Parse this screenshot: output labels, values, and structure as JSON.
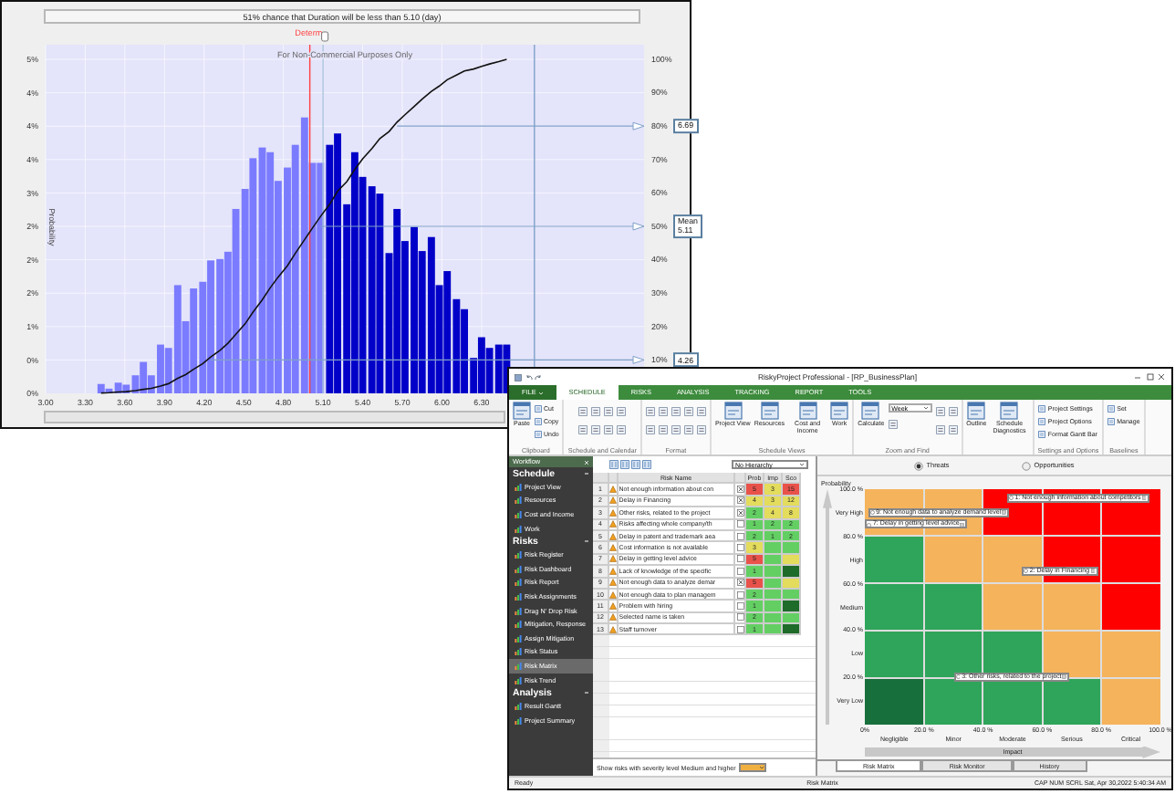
{
  "chart_window": {
    "header": "51% chance that Duration will be less than 5.10 (day)",
    "notice": "For Non-Commercial Purposes Only",
    "chart_data": {
      "type": "bar",
      "ylabel": "Probability",
      "x": [
        3.42,
        3.48,
        3.55,
        3.61,
        3.68,
        3.74,
        3.8,
        3.87,
        3.93,
        4.0,
        4.06,
        4.12,
        4.19,
        4.25,
        4.32,
        4.38,
        4.44,
        4.51,
        4.57,
        4.64,
        4.7,
        4.76,
        4.83,
        4.89,
        4.96,
        5.02,
        5.08,
        5.15,
        5.21,
        5.28,
        5.34,
        5.4,
        5.47,
        5.53,
        5.6,
        5.66,
        5.72,
        5.79,
        5.85,
        5.92,
        5.98,
        6.04,
        6.11,
        6.17,
        6.24,
        6.3,
        6.36,
        6.43,
        6.49
      ],
      "series": [
        {
          "color": "#7b7bff",
          "values": [
            0.14,
            0.07,
            0.16,
            0.13,
            0.27,
            0.47,
            0.27,
            0.73,
            0.68,
            1.62,
            1.08,
            1.57,
            1.67,
            1.99,
            2.01,
            2.12,
            2.76,
            3.06,
            3.52,
            3.68,
            3.61,
            3.18,
            3.38,
            3.72,
            4.13,
            3.45,
            3.45,
            null,
            null,
            null,
            null,
            null,
            null,
            null,
            null,
            null,
            null,
            null,
            null,
            null,
            null,
            null,
            null,
            null,
            null,
            null,
            null,
            null,
            null
          ]
        },
        {
          "color": "#0000c8",
          "values": [
            null,
            null,
            null,
            null,
            null,
            null,
            null,
            null,
            null,
            null,
            null,
            null,
            null,
            null,
            null,
            null,
            null,
            null,
            null,
            null,
            null,
            null,
            null,
            null,
            null,
            null,
            null,
            3.72,
            3.89,
            2.83,
            3.61,
            3.24,
            3.1,
            2.99,
            2.1,
            2.76,
            2.28,
            2.49,
            2.13,
            2.34,
            1.62,
            1.83,
            1.41,
            1.26,
            0.53,
            0.84,
            0.68,
            0.73,
            0.73
          ]
        },
        {
          "type": "line",
          "axis": "y2",
          "color": "#111111",
          "values": [
            0.001,
            0.002,
            0.004,
            0.005,
            0.008,
            0.012,
            0.015,
            0.022,
            0.029,
            0.045,
            0.056,
            0.072,
            0.089,
            0.109,
            0.129,
            0.15,
            0.177,
            0.208,
            0.243,
            0.28,
            0.316,
            0.348,
            0.382,
            0.419,
            0.46,
            0.495,
            0.529,
            0.566,
            0.605,
            0.634,
            0.67,
            0.702,
            0.733,
            0.763,
            0.784,
            0.812,
            0.834,
            0.859,
            0.881,
            0.904,
            0.92,
            0.939,
            0.953,
            0.965,
            0.971,
            0.979,
            0.986,
            0.993,
            1.0
          ]
        }
      ],
      "xlim": [
        3.0,
        7.53
      ],
      "ylim": [
        0,
        5
      ],
      "y2lim": [
        0,
        1
      ],
      "grid": true,
      "xticks": [
        {
          "value": 3.0,
          "label": "3.00"
        },
        {
          "value": 3.3,
          "label": "3.30"
        },
        {
          "value": 3.6,
          "label": "3.60"
        },
        {
          "value": 3.9,
          "label": "3.90"
        },
        {
          "value": 4.2,
          "label": "4.20"
        },
        {
          "value": 4.5,
          "label": "4.50"
        },
        {
          "value": 4.8,
          "label": "4.80"
        },
        {
          "value": 5.1,
          "label": "5.10"
        },
        {
          "value": 5.4,
          "label": "5.40"
        },
        {
          "value": 5.7,
          "label": "5.70"
        },
        {
          "value": 6.0,
          "label": "6.00"
        },
        {
          "value": 6.3,
          "label": "6.30"
        }
      ],
      "yticks": [
        {
          "value": 0,
          "label": "0%"
        },
        {
          "value": 0.5,
          "label": "0%"
        },
        {
          "value": 1,
          "label": "1%"
        },
        {
          "value": 1.5,
          "label": "2%"
        },
        {
          "value": 2,
          "label": "2%"
        },
        {
          "value": 2.5,
          "label": "2%"
        },
        {
          "value": 3,
          "label": "3%"
        },
        {
          "value": 3.5,
          "label": "4%"
        },
        {
          "value": 4,
          "label": "4%"
        },
        {
          "value": 4.5,
          "label": "4%"
        },
        {
          "value": 5,
          "label": "5%"
        }
      ],
      "y2ticks": [
        {
          "value": 0.1,
          "label": "10%"
        },
        {
          "value": 0.2,
          "label": "20%"
        },
        {
          "value": 0.3,
          "label": "30%"
        },
        {
          "value": 0.4,
          "label": "40%"
        },
        {
          "value": 0.5,
          "label": "50%"
        },
        {
          "value": 0.6,
          "label": "60%"
        },
        {
          "value": 0.7,
          "label": "70%"
        },
        {
          "value": 0.8,
          "label": "80%"
        },
        {
          "value": 0.9,
          "label": "90%"
        },
        {
          "value": 1,
          "label": "100%"
        }
      ],
      "ref_lines": [
        {
          "axis": "x",
          "value": 5.1,
          "color": "#a8c4dc"
        },
        {
          "axis": "x",
          "value": 5.0,
          "color": "#ff4040",
          "label": "Determ."
        },
        {
          "axis": "x",
          "value": 6.7,
          "color": "#7fa0c8"
        },
        {
          "axis": "y2",
          "value": 0.8,
          "color": "#7fa0c8"
        },
        {
          "axis": "y2",
          "value": 0.5,
          "color": "#7fa0c8"
        },
        {
          "axis": "y2",
          "value": 0.1,
          "color": "#7fa0c8"
        }
      ],
      "annotations": [
        "6.69",
        "Mean 5.11",
        "4.26"
      ]
    }
  },
  "app": {
    "title": "RiskyProject Professional - [RP_BusinessPlan]",
    "ribbon_tabs": [
      {
        "label": "FILE",
        "kind": "menu",
        "selected": false
      },
      {
        "label": "SCHEDULE",
        "kind": "tab",
        "selected": true
      },
      {
        "label": "RISKS",
        "kind": "tab",
        "selected": false
      },
      {
        "label": "ANALYSIS",
        "kind": "tab",
        "selected": false
      },
      {
        "label": "TRACKING",
        "kind": "tab",
        "selected": false
      },
      {
        "label": "REPORT",
        "kind": "tab",
        "selected": false
      },
      {
        "label": "TOOLS",
        "kind": "tab",
        "selected": false
      }
    ],
    "ribbon_groups": [
      {
        "label": "Clipboard",
        "items": [
          {
            "kind": "large",
            "label": "Paste"
          },
          {
            "kind": "small",
            "label": "Cut"
          },
          {
            "kind": "small",
            "label": "Copy"
          },
          {
            "kind": "small",
            "label": "Undo"
          }
        ]
      },
      {
        "label": "Schedule and Calendar",
        "items": [
          {
            "kind": "icon"
          },
          {
            "kind": "icon"
          },
          {
            "kind": "icon"
          },
          {
            "kind": "icon"
          },
          {
            "kind": "icon"
          },
          {
            "kind": "icon"
          },
          {
            "kind": "icon"
          },
          {
            "kind": "icon"
          }
        ]
      },
      {
        "label": "Format",
        "items": [
          {
            "kind": "icon"
          },
          {
            "kind": "icon"
          },
          {
            "kind": "icon"
          },
          {
            "kind": "icon"
          },
          {
            "kind": "icon"
          },
          {
            "kind": "icon"
          },
          {
            "kind": "icon"
          },
          {
            "kind": "icon"
          },
          {
            "kind": "icon"
          },
          {
            "kind": "icon"
          }
        ]
      },
      {
        "label": "Schedule Views",
        "items": [
          {
            "kind": "large",
            "label": "Project View"
          },
          {
            "kind": "large",
            "label": "Resources"
          },
          {
            "kind": "large",
            "label": "Cost and Income"
          },
          {
            "kind": "large",
            "label": "Work"
          }
        ]
      },
      {
        "label": "Zoom and Find",
        "items": [
          {
            "kind": "large",
            "label": "Calculate"
          },
          {
            "kind": "dropdown",
            "label": "Week"
          },
          {
            "kind": "icon"
          },
          {
            "kind": "icon"
          },
          {
            "kind": "icon"
          },
          {
            "kind": "icon"
          },
          {
            "kind": "icon"
          }
        ]
      },
      {
        "items": [
          {
            "kind": "large",
            "label": "Outline"
          },
          {
            "kind": "large",
            "label": "Schedule Diagnostics"
          }
        ]
      },
      {
        "label": "Settings and Options",
        "items": [
          {
            "kind": "small",
            "label": "Project Settings"
          },
          {
            "kind": "small",
            "label": "Project Options"
          },
          {
            "kind": "small",
            "label": "Format Gantt Bar"
          }
        ]
      },
      {
        "label": "Baselines",
        "items": [
          {
            "kind": "small",
            "label": "Set"
          },
          {
            "kind": "small",
            "label": "Manage"
          }
        ]
      }
    ],
    "sidebar": {
      "title": "Workflow",
      "sections": [
        {
          "title": "Schedule",
          "items": [
            {
              "label": "Project View",
              "selected": false
            },
            {
              "label": "Resources",
              "selected": false
            },
            {
              "label": "Cost and Income",
              "selected": false
            },
            {
              "label": "Work",
              "selected": false
            }
          ]
        },
        {
          "title": "Risks",
          "items": [
            {
              "label": "Risk Register",
              "selected": false
            },
            {
              "label": "Risk Dashboard",
              "selected": false
            },
            {
              "label": "Risk Report",
              "selected": false
            },
            {
              "label": "Risk Assignments",
              "selected": false
            },
            {
              "label": "Drag N' Drop Risk",
              "selected": false
            },
            {
              "label": "Mitigation, Response",
              "selected": false
            },
            {
              "label": "Assign Mitigation",
              "selected": false
            },
            {
              "label": "Risk Status",
              "selected": false
            },
            {
              "label": "Risk Matrix",
              "selected": true
            },
            {
              "label": "Risk Trend",
              "selected": false
            }
          ]
        },
        {
          "title": "Analysis",
          "items": [
            {
              "label": "Result Gantt",
              "selected": false
            },
            {
              "label": "Project Summary",
              "selected": false
            }
          ]
        }
      ]
    },
    "table": {
      "dropdown": "No Hierarchy",
      "columns": [
        "Risk Name",
        "Prob",
        "Imp",
        "Sco"
      ],
      "rows": [
        {
          "number": "1",
          "name": "Not enough information about con",
          "checked": true,
          "prob": {
            "text": "5",
            "color": "#e8524a"
          },
          "imp": {
            "text": "3",
            "color": "#e3dc5c"
          },
          "score": {
            "text": "15",
            "color": "#e8524a"
          }
        },
        {
          "number": "2",
          "name": "Delay in Financing",
          "checked": true,
          "prob": {
            "text": "4",
            "color": "#e3dc5c"
          },
          "imp": {
            "text": "3",
            "color": "#e3dc5c"
          },
          "score": {
            "text": "12",
            "color": "#e3dc5c"
          }
        },
        {
          "number": "3",
          "name": "Other risks, related to the project",
          "checked": true,
          "prob": {
            "text": "2",
            "color": "#63cf63"
          },
          "imp": {
            "text": "4",
            "color": "#e3dc5c"
          },
          "score": {
            "text": "8",
            "color": "#e3dc5c"
          }
        },
        {
          "number": "4",
          "name": "Risks affecting whole company/th",
          "checked": false,
          "prob": {
            "text": "1",
            "color": "#63cf63"
          },
          "imp": {
            "text": "2",
            "color": "#63cf63"
          },
          "score": {
            "text": "2",
            "color": "#63cf63"
          }
        },
        {
          "number": "5",
          "name": "Delay in patent and trademark aea",
          "checked": false,
          "prob": {
            "text": "2",
            "color": "#63cf63"
          },
          "imp": {
            "text": "1",
            "color": "#63cf63"
          },
          "score": {
            "text": "2",
            "color": "#63cf63"
          }
        },
        {
          "number": "6",
          "name": "Cost information is not available",
          "checked": false,
          "prob": {
            "text": "3",
            "color": "#e3dc5c"
          },
          "imp": {
            "color": "#63cf63"
          },
          "score": {
            "color": "#63cf63"
          }
        },
        {
          "number": "7",
          "name": "Delay in getting level advice",
          "checked": false,
          "prob": {
            "text": "5",
            "color": "#e8524a"
          },
          "imp": {
            "color": "#63cf63"
          },
          "score": {
            "color": "#e3dc5c"
          }
        },
        {
          "number": "8",
          "name": "Lack of knowledge of the specific",
          "checked": false,
          "prob": {
            "text": "1",
            "color": "#63cf63"
          },
          "imp": {
            "color": "#63cf63"
          },
          "score": {
            "color": "#1f6b2a"
          }
        },
        {
          "number": "9",
          "name": "Not enough data to analyze demar",
          "checked": true,
          "prob": {
            "text": "5",
            "color": "#e8524a"
          },
          "imp": {
            "color": "#63cf63"
          },
          "score": {
            "color": "#e3dc5c"
          }
        },
        {
          "number": "10",
          "name": "Not enough data to plan managem",
          "checked": false,
          "prob": {
            "text": "2",
            "color": "#63cf63"
          },
          "imp": {
            "color": "#63cf63"
          },
          "score": {
            "color": "#63cf63"
          }
        },
        {
          "number": "11",
          "name": "Problem with hiring",
          "checked": false,
          "prob": {
            "text": "1",
            "color": "#63cf63"
          },
          "imp": {
            "color": "#63cf63"
          },
          "score": {
            "color": "#1f6b2a"
          }
        },
        {
          "number": "12",
          "name": "Selected name is taken",
          "checked": false,
          "prob": {
            "text": "2",
            "color": "#63cf63"
          },
          "imp": {
            "color": "#63cf63"
          },
          "score": {
            "color": "#63cf63"
          }
        },
        {
          "number": "13",
          "name": "Staff turnover",
          "checked": false,
          "prob": {
            "text": "1",
            "color": "#63cf63"
          },
          "imp": {
            "color": "#63cf63"
          },
          "score": {
            "color": "#1f6b2a"
          }
        }
      ],
      "filter_label": "Show risks with severity level Medium and higher"
    },
    "matrix": {
      "tabs": [
        {
          "label": "Threats",
          "selected": true
        },
        {
          "label": "Opportunities",
          "selected": false
        }
      ],
      "rows": [
        {
          "label": "Very High",
          "cells": [
            {
              "color": "#f5b35c"
            },
            {
              "color": "#f5b35c"
            },
            {
              "color": "#ff0000"
            },
            {
              "color": "#ff0000"
            },
            {
              "color": "#ff0000"
            }
          ]
        },
        {
          "label": "High",
          "cells": [
            {
              "color": "#2ea55a"
            },
            {
              "color": "#f5b35c"
            },
            {
              "color": "#f5b35c"
            },
            {
              "color": "#ff0000"
            },
            {
              "color": "#ff0000"
            }
          ]
        },
        {
          "label": "Medium",
          "cells": [
            {
              "color": "#2ea55a"
            },
            {
              "color": "#2ea55a"
            },
            {
              "color": "#f5b35c"
            },
            {
              "color": "#f5b35c"
            },
            {
              "color": "#ff0000"
            }
          ]
        },
        {
          "label": "Low",
          "cells": [
            {
              "color": "#2ea55a"
            },
            {
              "color": "#2ea55a"
            },
            {
              "color": "#2ea55a"
            },
            {
              "color": "#f5b35c"
            },
            {
              "color": "#f5b35c"
            }
          ]
        },
        {
          "label": "Very Low",
          "cells": [
            {
              "color": "#17703c"
            },
            {
              "color": "#2ea55a"
            },
            {
              "color": "#2ea55a"
            },
            {
              "color": "#2ea55a"
            },
            {
              "color": "#f5b35c"
            }
          ]
        }
      ],
      "columns": [
        "Negligible",
        "Minor",
        "Moderate",
        "Serious",
        "Critical"
      ],
      "chart_data": {
        "type": "scatter",
        "xlabel": "Impact",
        "ylabel": "Probability",
        "xlim": [
          0,
          100
        ],
        "ylim": [
          0,
          100
        ],
        "xticks": [
          {
            "value": 0,
            "label": "0%"
          },
          {
            "value": 20,
            "label": "20.0 %"
          },
          {
            "value": 40,
            "label": "40.0 %"
          },
          {
            "value": 60,
            "label": "60.0 %"
          },
          {
            "value": 80,
            "label": "80.0 %"
          },
          {
            "value": 100,
            "label": "100.0 %"
          }
        ],
        "yticks": [
          {
            "value": 20,
            "label": "20.0 %"
          },
          {
            "value": 40,
            "label": "40.0 %"
          },
          {
            "value": 60,
            "label": "60.0 %"
          },
          {
            "value": 80,
            "label": "80.0 %"
          },
          {
            "value": 100,
            "label": "100.0 %"
          }
        ],
        "annotations": [
          "1: Not enough information about competitors",
          "9: Not enough data to analyze demand level",
          "7: Delay in getting level advice",
          "2: Delay in Financing",
          "3: Other risks, related to the project"
        ]
      },
      "view_tabs": [
        {
          "label": "Risk Matrix",
          "selected": true
        },
        {
          "label": "Risk Monitor",
          "selected": false
        },
        {
          "label": "History",
          "selected": false
        }
      ]
    },
    "status": {
      "left": "Ready",
      "center": "Risk Matrix",
      "right": "CAP  NUM  SCRL  Sat, Apr 30,2022  5:40:34 AM"
    }
  }
}
